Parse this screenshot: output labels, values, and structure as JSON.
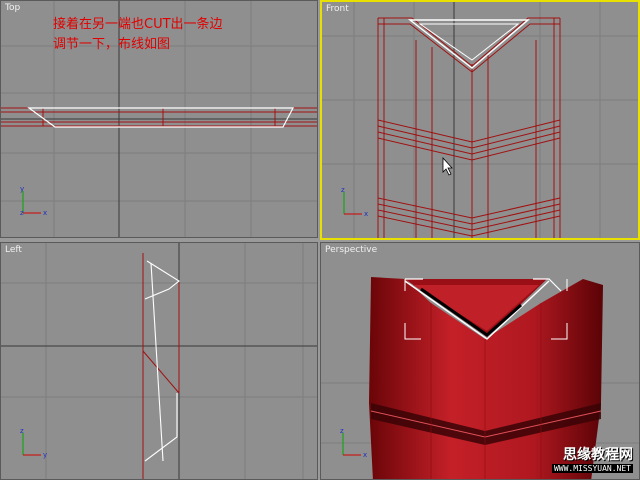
{
  "viewports": {
    "top": {
      "label": "Top"
    },
    "front": {
      "label": "Front"
    },
    "left": {
      "label": "Left"
    },
    "perspective": {
      "label": "Perspective"
    }
  },
  "annotation": {
    "line1": "接着在另一端也CUT出一条边",
    "line2": "调节一下，布线如图"
  },
  "watermark": {
    "site_name": "思缘教程网",
    "url": "WWW.MISSYUAN.NET"
  },
  "colors": {
    "viewport_bg": "#8f8f8f",
    "grid": "#7e7e7e",
    "active_border": "#e8e000",
    "wire_red": "#a01010",
    "wire_white": "#ffffff",
    "annotation": "#e00000"
  },
  "axis_labels": {
    "x": "x",
    "y": "y",
    "z": "z"
  }
}
